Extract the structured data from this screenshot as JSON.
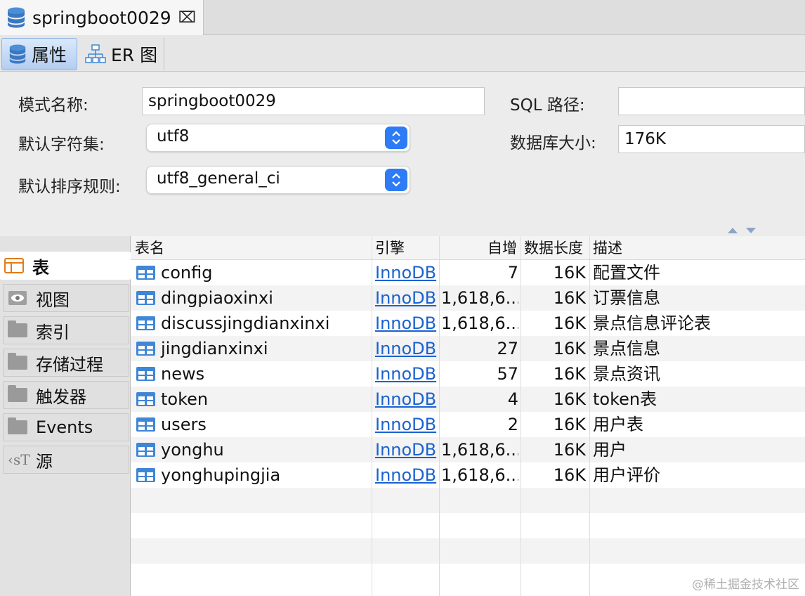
{
  "editor_tab": {
    "title": "springboot0029",
    "close_icon": "close-icon"
  },
  "subtabs": [
    {
      "label": "属性",
      "icon": "database-icon",
      "active": true
    },
    {
      "label": "ER 图",
      "icon": "er-diagram-icon",
      "active": false
    }
  ],
  "form": {
    "schema_name_label": "模式名称:",
    "schema_name_value": "springboot0029",
    "charset_label": "默认字符集:",
    "charset_value": "utf8",
    "collation_label": "默认排序规则:",
    "collation_value": "utf8_general_ci",
    "sql_path_label": "SQL 路径:",
    "sql_path_value": "",
    "db_size_label": "数据库大小:",
    "db_size_value": "176K"
  },
  "nav": [
    {
      "label": "表",
      "icon": "table-icon",
      "active": true
    },
    {
      "label": "视图",
      "icon": "eye-icon",
      "active": false
    },
    {
      "label": "索引",
      "icon": "folder-icon",
      "active": false
    },
    {
      "label": "存储过程",
      "icon": "folder-icon",
      "active": false
    },
    {
      "label": "触发器",
      "icon": "folder-icon",
      "active": false
    },
    {
      "label": "Events",
      "icon": "folder-icon",
      "active": false
    },
    {
      "label": "源",
      "icon": "source-icon",
      "active": false
    }
  ],
  "table": {
    "columns": [
      "表名",
      "引擎",
      "自增",
      "数据长度",
      "描述"
    ],
    "rows": [
      {
        "name": "config",
        "engine": "InnoDB",
        "auto_increment": "7",
        "data_length": "16K",
        "description": "配置文件"
      },
      {
        "name": "dingpiaoxinxi",
        "engine": "InnoDB",
        "auto_increment": "1,618,6...",
        "data_length": "16K",
        "description": "订票信息"
      },
      {
        "name": "discussjingdianxinxi",
        "engine": "InnoDB",
        "auto_increment": "1,618,6...",
        "data_length": "16K",
        "description": "景点信息评论表"
      },
      {
        "name": "jingdianxinxi",
        "engine": "InnoDB",
        "auto_increment": "27",
        "data_length": "16K",
        "description": "景点信息"
      },
      {
        "name": "news",
        "engine": "InnoDB",
        "auto_increment": "57",
        "data_length": "16K",
        "description": "景点资讯"
      },
      {
        "name": "token",
        "engine": "InnoDB",
        "auto_increment": "4",
        "data_length": "16K",
        "description": "token表"
      },
      {
        "name": "users",
        "engine": "InnoDB",
        "auto_increment": "2",
        "data_length": "16K",
        "description": "用户表"
      },
      {
        "name": "yonghu",
        "engine": "InnoDB",
        "auto_increment": "1,618,6...",
        "data_length": "16K",
        "description": "用户"
      },
      {
        "name": "yonghupingjia",
        "engine": "InnoDB",
        "auto_increment": "1,618,6...",
        "data_length": "16K",
        "description": "用户评价"
      }
    ]
  },
  "watermark": "@稀土掘金技术社区",
  "colors": {
    "accent": "#2d7bf5",
    "link": "#1a62d0",
    "table_icon": "#3f86d6"
  }
}
